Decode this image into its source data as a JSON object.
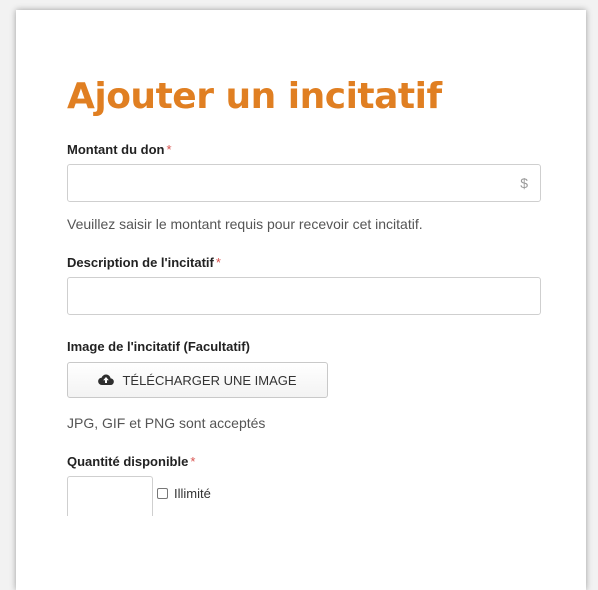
{
  "form": {
    "title": "Ajouter un incitatif",
    "required_marker": "*",
    "amount": {
      "label": "Montant du don",
      "value": "",
      "currency_symbol": "$",
      "help": "Veuillez saisir le montant requis pour recevoir cet incitatif."
    },
    "description": {
      "label": "Description de l'incitatif",
      "value": ""
    },
    "image": {
      "label": "Image de l'incitatif (Facultatif)",
      "upload_button": "TÉLÉCHARGER UNE IMAGE",
      "upload_icon": "cloud-upload-icon",
      "help": "JPG, GIF et PNG sont acceptés"
    },
    "quantity": {
      "label": "Quantité disponible",
      "value": "",
      "unlimited_label": "Illimité",
      "unlimited_checked": false
    }
  },
  "colors": {
    "title": "#e07f22",
    "required": "#d9534f"
  }
}
